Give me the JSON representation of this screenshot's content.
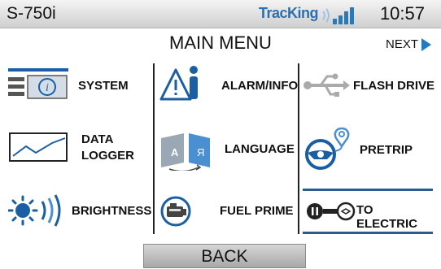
{
  "status": {
    "model": "S-750i",
    "brand": "TracKing",
    "time": "10:57"
  },
  "header": {
    "title": "MAIN MENU",
    "next": "NEXT"
  },
  "menu": {
    "system": "SYSTEM",
    "alarm_info": "ALARM/INFO",
    "flash_drive": "FLASH DRIVE",
    "data_logger_1": "DATA",
    "data_logger_2": "LOGGER",
    "language": "LANGUAGE",
    "pretrip": "PRETRIP",
    "brightness": "BRIGHTNESS",
    "fuel_prime": "FUEL PRIME",
    "to_electric": "TO ELECTRIC"
  },
  "footer": {
    "back": "BACK"
  },
  "colors": {
    "accent": "#1e7bc4",
    "icon_blue": "#1a5fa3",
    "divider": "#222222"
  }
}
